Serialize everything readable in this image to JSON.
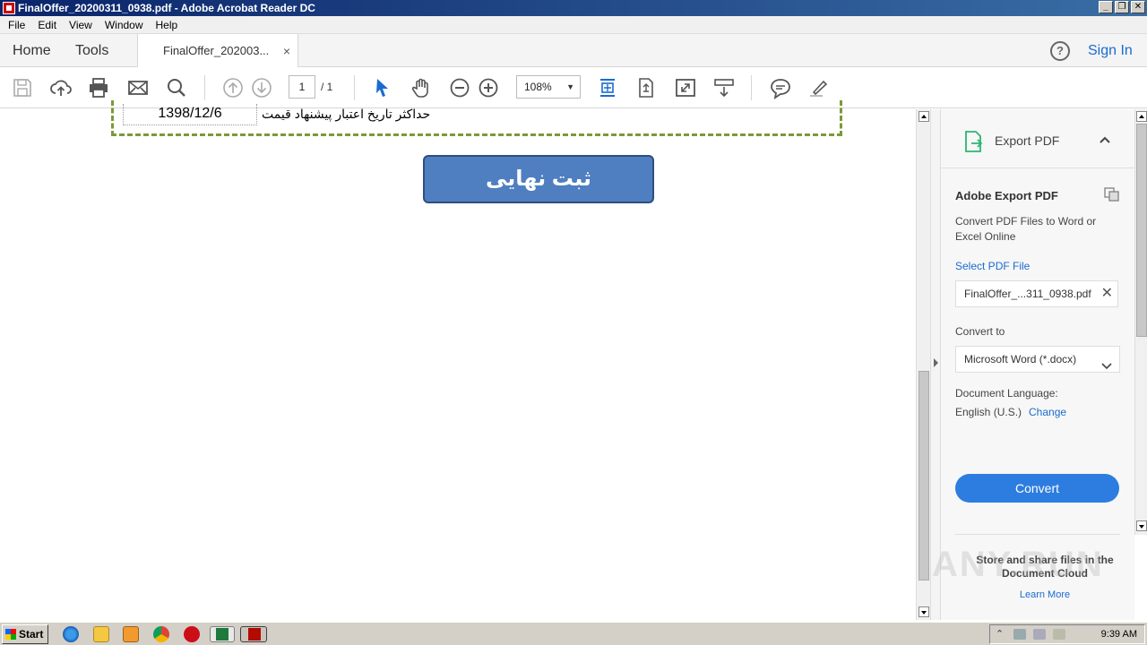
{
  "window": {
    "title": "FinalOffer_20200311_0938.pdf - Adobe Acrobat Reader DC",
    "minimize": "_",
    "restore": "❐",
    "close": "✕"
  },
  "menu": [
    "File",
    "Edit",
    "View",
    "Window",
    "Help"
  ],
  "tabs": {
    "home": "Home",
    "tools": "Tools",
    "document": "FinalOffer_202003...",
    "document_close": "×",
    "help": "?",
    "sign_in": "Sign In"
  },
  "toolbar": {
    "page_current": "1",
    "page_total": "/ 1",
    "zoom": "108%",
    "zoom_dropdown": "▼"
  },
  "document": {
    "date_value": "1398/12/6",
    "date_label": "حداکثر تاریخ اعتبار پیشنهاد قیمت",
    "submit_button": "ثبت نهایی"
  },
  "export_panel": {
    "header": "Export PDF",
    "title": "Adobe Export PDF",
    "description": "Convert PDF Files to Word or Excel Online",
    "select_label": "Select PDF File",
    "file_name": "FinalOffer_...311_0938.pdf",
    "file_clear": "✕",
    "convert_to_label": "Convert to",
    "format": "Microsoft Word (*.docx)",
    "language_label": "Document Language:",
    "language_value": "English (U.S.)",
    "language_change": "Change",
    "convert_button": "Convert",
    "store_text": "Store and share files in the Document Cloud",
    "learn_more": "Learn More"
  },
  "watermark": "ANY.RUN",
  "taskbar": {
    "start": "Start",
    "clock": "9:39 AM"
  },
  "colors": {
    "accent": "#2d7de0",
    "link": "#1a6bd0",
    "submit_fill": "#4f7fc1",
    "form_border": "#7a9a3a"
  }
}
